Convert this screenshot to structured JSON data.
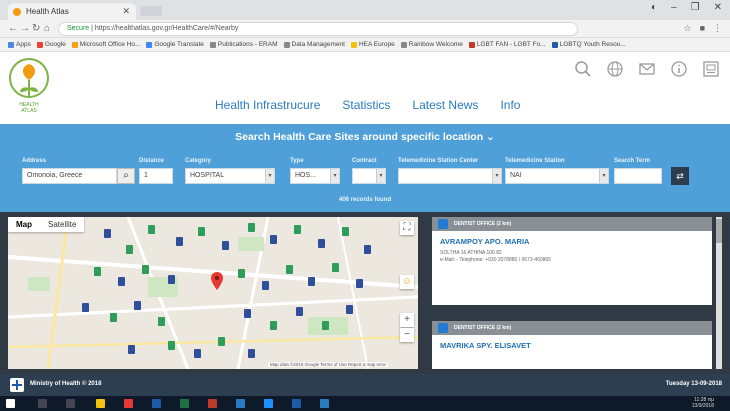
{
  "browser": {
    "tab_title": "Health Atlas",
    "address": "https://healthatlas.gov.gr/HealthCare/#/Nearby",
    "address_secure": "Secure",
    "bookmarks": [
      "Apps",
      "Google",
      "Microsoft Office Ho...",
      "Google Translate",
      "Publications - ERAM",
      "Data Management",
      "HEA Europe",
      "Rainbow Welcome",
      "LGBT FAN - LGBT Fo...",
      "LGBTQ Youth Resou..."
    ]
  },
  "site": {
    "logo_caption": "HEALTH\nATLAS",
    "nav": [
      "Health Infrastrucure",
      "Statistics",
      "Latest News",
      "Info"
    ]
  },
  "search": {
    "title": "Search Health Care Sites around specific location",
    "labels": {
      "address": "Address",
      "distance": "Distance",
      "category": "Category",
      "type": "Type",
      "contract": "Contract",
      "tel_station_center": "Telemedicine Station Center",
      "tel_station": "Telemedicine Station",
      "search_term": "Search Term"
    },
    "values": {
      "address": "Omonoia, Greece",
      "distance": "1",
      "category": "HOSPITAL",
      "type": "HOS...",
      "contract": "",
      "tel_station_center": "",
      "tel_station": "ΝΑΙ",
      "search_term": ""
    },
    "results_count": "406 records found"
  },
  "map": {
    "tab_map": "Map",
    "tab_satellite": "Satellite",
    "attribution": "Map data ©2018 Google   Terms of Use   Report a map error"
  },
  "results": [
    {
      "header": "DENTIST OFFICE (2 km)",
      "name": "AVRAMPOY APO. MARIA",
      "line1": "SOLTHA 16 ATHINA 106 82",
      "line2": "e-Mail: -   Telephone: +030 2078880 / 0673-460865"
    },
    {
      "header": "DENTIST OFFICE (2 km)",
      "name": "MAVRIKA SPY. ELISAVET",
      "line1": "",
      "line2": ""
    }
  ],
  "footer": {
    "text": "Ministry of Health © 2018",
    "date": "Tuesday 13-09-2018"
  },
  "taskbar": {
    "time": "11:28 πμ",
    "date": "13/9/2018"
  },
  "colors": {
    "accent": "#4f9fd9",
    "dark": "#2c3e50",
    "nav_link": "#2a7bbf",
    "pin_green": "#2f9d5a",
    "pin_blue": "#2f4f9d"
  }
}
